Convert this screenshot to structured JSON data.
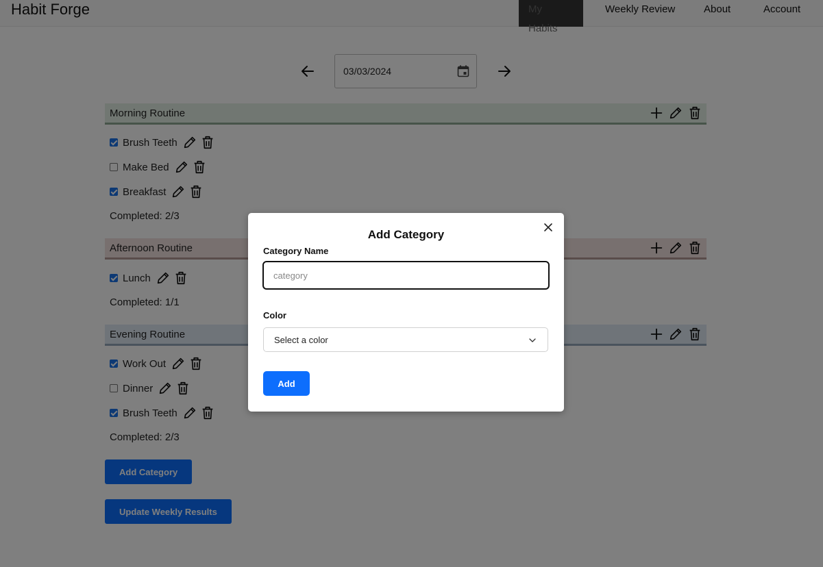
{
  "header": {
    "brand": "Habit Forge",
    "nav": [
      "My Habits",
      "Weekly Review",
      "About",
      "Account"
    ],
    "active_nav": "My Habits"
  },
  "date_nav": {
    "date": "03/03/2024"
  },
  "categories": [
    {
      "title": "Morning Routine",
      "color": "#e3efe5",
      "habits": [
        {
          "label": "Brush Teeth",
          "checked": true
        },
        {
          "label": "Make Bed",
          "checked": false
        },
        {
          "label": "Breakfast",
          "checked": true
        }
      ],
      "completed": "Completed: 2/3"
    },
    {
      "title": "Afternoon Routine",
      "color": "#f1e1df",
      "habits": [
        {
          "label": "Lunch",
          "checked": true
        }
      ],
      "completed": "Completed: 1/1"
    },
    {
      "title": "Evening Routine",
      "color": "#dfe8f3",
      "habits": [
        {
          "label": "Work Out",
          "checked": true
        },
        {
          "label": "Dinner",
          "checked": false
        },
        {
          "label": "Brush Teeth",
          "checked": true
        }
      ],
      "completed": "Completed: 2/3"
    }
  ],
  "actions": {
    "add_category": "Add Category",
    "update_weekly": "Update Weekly Results"
  },
  "modal": {
    "title": "Add Category",
    "name_label": "Category Name",
    "name_placeholder": "category",
    "name_value": "",
    "color_label": "Color",
    "color_selected": "Select a color",
    "submit": "Add"
  },
  "icons": {
    "plus": "plus-icon",
    "edit": "pencil-icon",
    "delete": "trash-icon",
    "calendar": "calendar-icon",
    "arrow_left": "arrow-left-icon",
    "arrow_right": "arrow-right-icon",
    "close": "close-icon",
    "chevron": "chevron-down-icon"
  },
  "colors": {
    "primary": "#0d6efd",
    "overlay": "rgba(0,0,0,0.5)"
  }
}
